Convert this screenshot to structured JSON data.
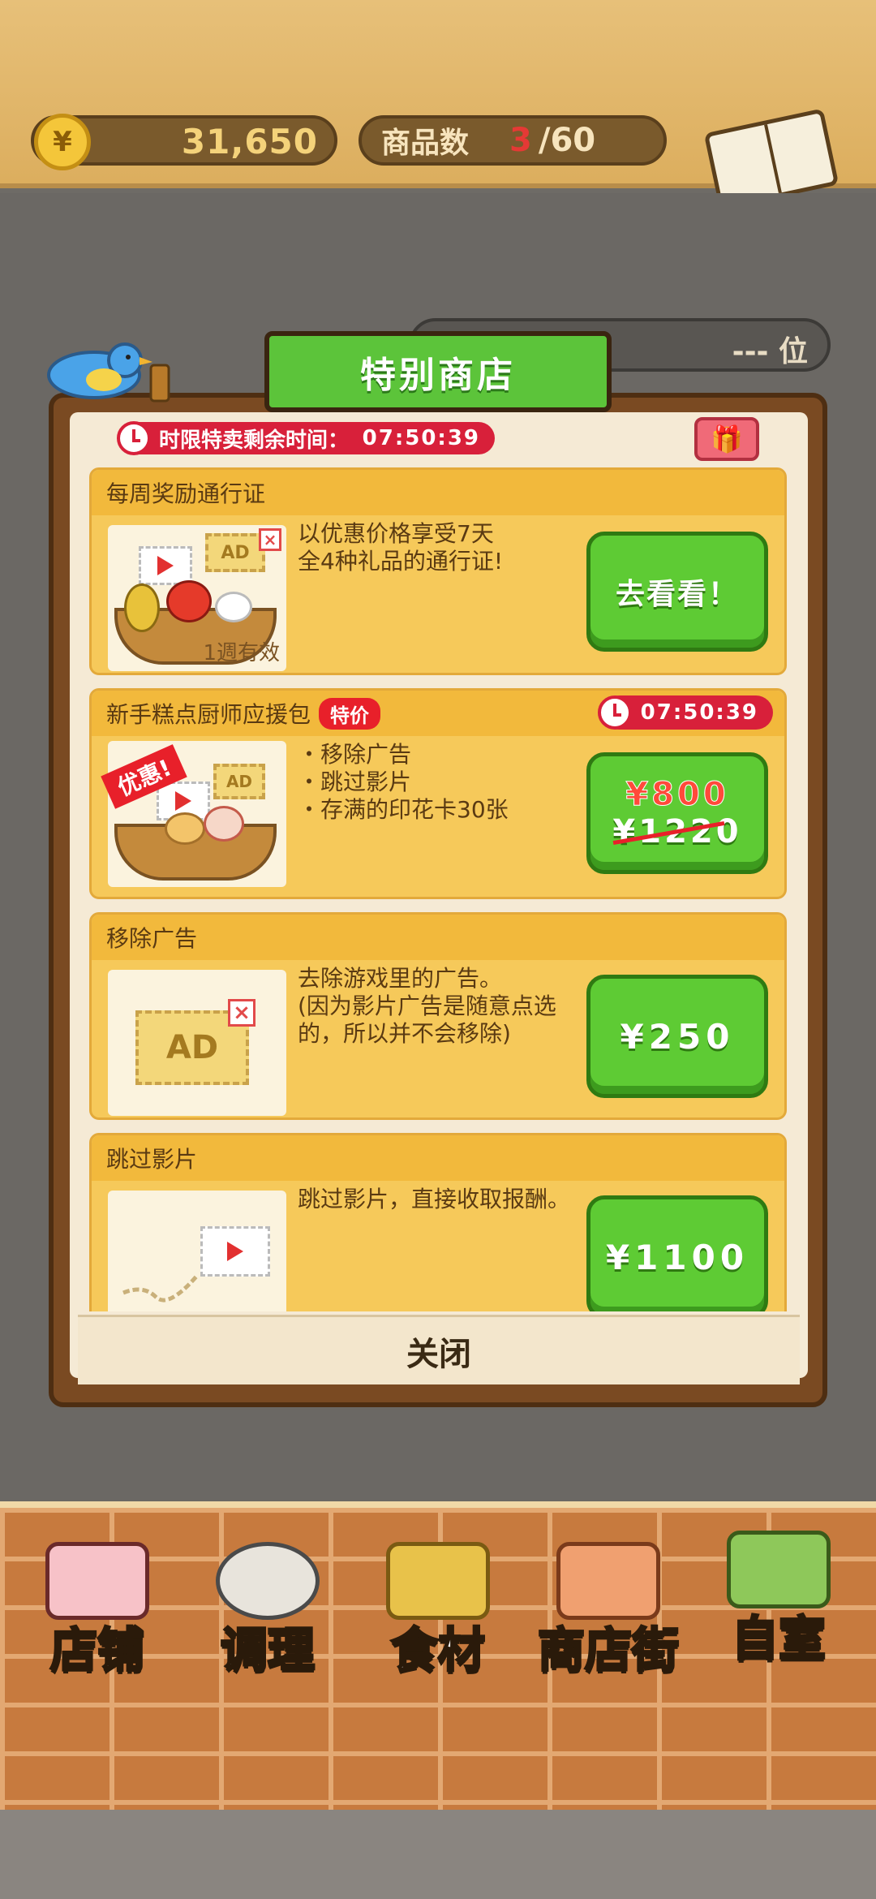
{
  "header": {
    "coins": "31,650",
    "coin_symbol": "¥",
    "items_label": "商品数",
    "items_count": "3",
    "items_max": "/60",
    "recipe_label": "食谱"
  },
  "background": {
    "rank_text": "--- 位"
  },
  "modal": {
    "title": "特别商店",
    "timer_label": "时限特卖剩余时间：",
    "timer_value": "07:50:39",
    "gift_icon": "gift-icon",
    "close_label": "关闭",
    "cards": [
      {
        "title": "每周奖励通行证",
        "desc": "以优惠价格享受7天\n全4种礼品的通行证!",
        "image_note": "1週有效",
        "button": "去看看！"
      },
      {
        "title": "新手糕点厨师应援包",
        "badge": "特价",
        "timer": "07:50:39",
        "image_note": "优惠!",
        "desc": "・移除广告\n・跳过影片\n・存满的印花卡30张",
        "price_new": "¥800",
        "price_old": "¥1220"
      },
      {
        "title": "移除广告",
        "desc": "去除游戏里的广告。\n(因为影片广告是随意点选的，所以并不会移除)",
        "ad_text": "AD",
        "price": "¥250"
      },
      {
        "title": "跳过影片",
        "desc": "跳过影片，直接收取报酬。",
        "price": "¥1100"
      }
    ]
  },
  "nav": {
    "items": [
      {
        "label": "店铺",
        "icon": "cake-icon"
      },
      {
        "label": "调理",
        "icon": "whisk-bowl-icon"
      },
      {
        "label": "食材",
        "icon": "flour-bag-icon"
      },
      {
        "label": "商店街",
        "icon": "shop-icon"
      },
      {
        "label": "自室",
        "icon": "staff-only-sign-icon"
      }
    ]
  }
}
